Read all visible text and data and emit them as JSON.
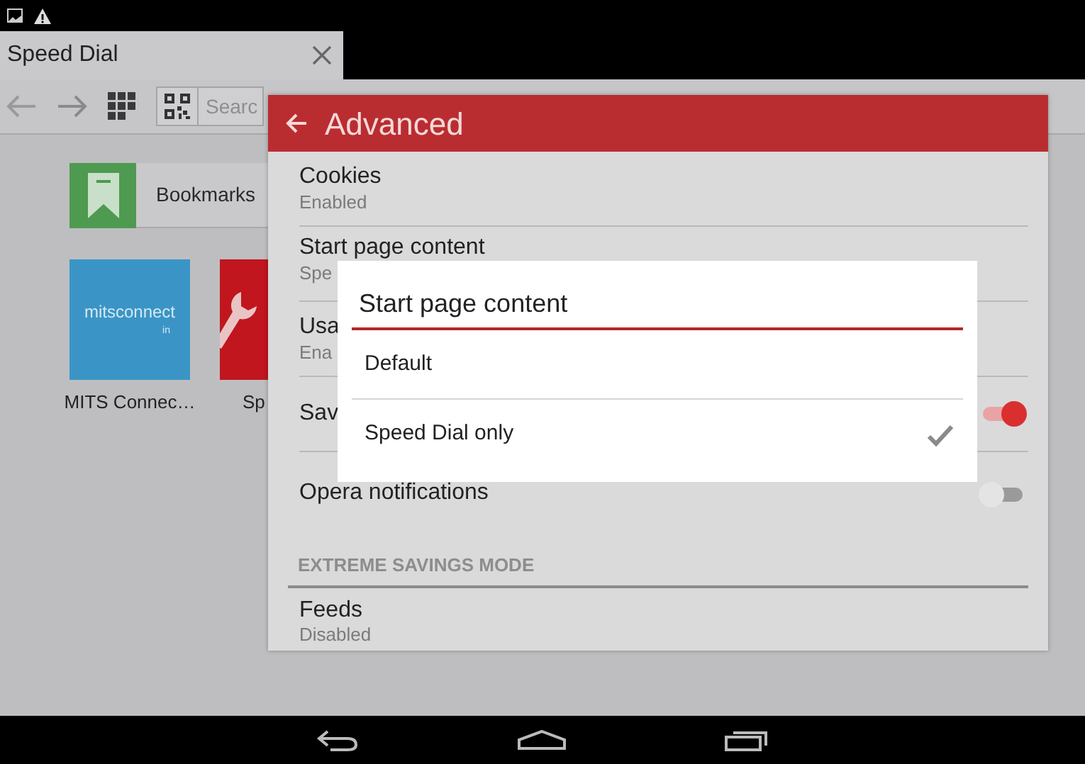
{
  "tab": {
    "title": "Speed Dial"
  },
  "toolbar": {
    "search": {
      "placeholder": "Searc"
    }
  },
  "speed_dial": {
    "bookmarks": {
      "label": "Bookmarks"
    },
    "tiles": [
      {
        "label": "MITS Connec…",
        "logo": "mitsconnect",
        "logo_sub": "in",
        "color": "#3a95c6"
      },
      {
        "label": "Sp",
        "color": "#c1161d"
      }
    ]
  },
  "settings": {
    "title": "Advanced",
    "items": [
      {
        "kind": "text",
        "title": "Cookies",
        "value": "Enabled"
      },
      {
        "kind": "text",
        "title": "Start page content",
        "value": "Spe"
      },
      {
        "kind": "text",
        "title": "Usa",
        "value": "Ena"
      },
      {
        "kind": "toggle",
        "title": "Sav",
        "on": true
      },
      {
        "kind": "toggle",
        "title": "Opera notifications",
        "on": false
      },
      {
        "kind": "section",
        "title": "EXTREME SAVINGS MODE"
      },
      {
        "kind": "text",
        "title": "Feeds",
        "value": "Disabled"
      }
    ]
  },
  "dialog": {
    "title": "Start page content",
    "options": [
      {
        "label": "Default",
        "selected": false
      },
      {
        "label": "Speed Dial only",
        "selected": true
      }
    ]
  }
}
